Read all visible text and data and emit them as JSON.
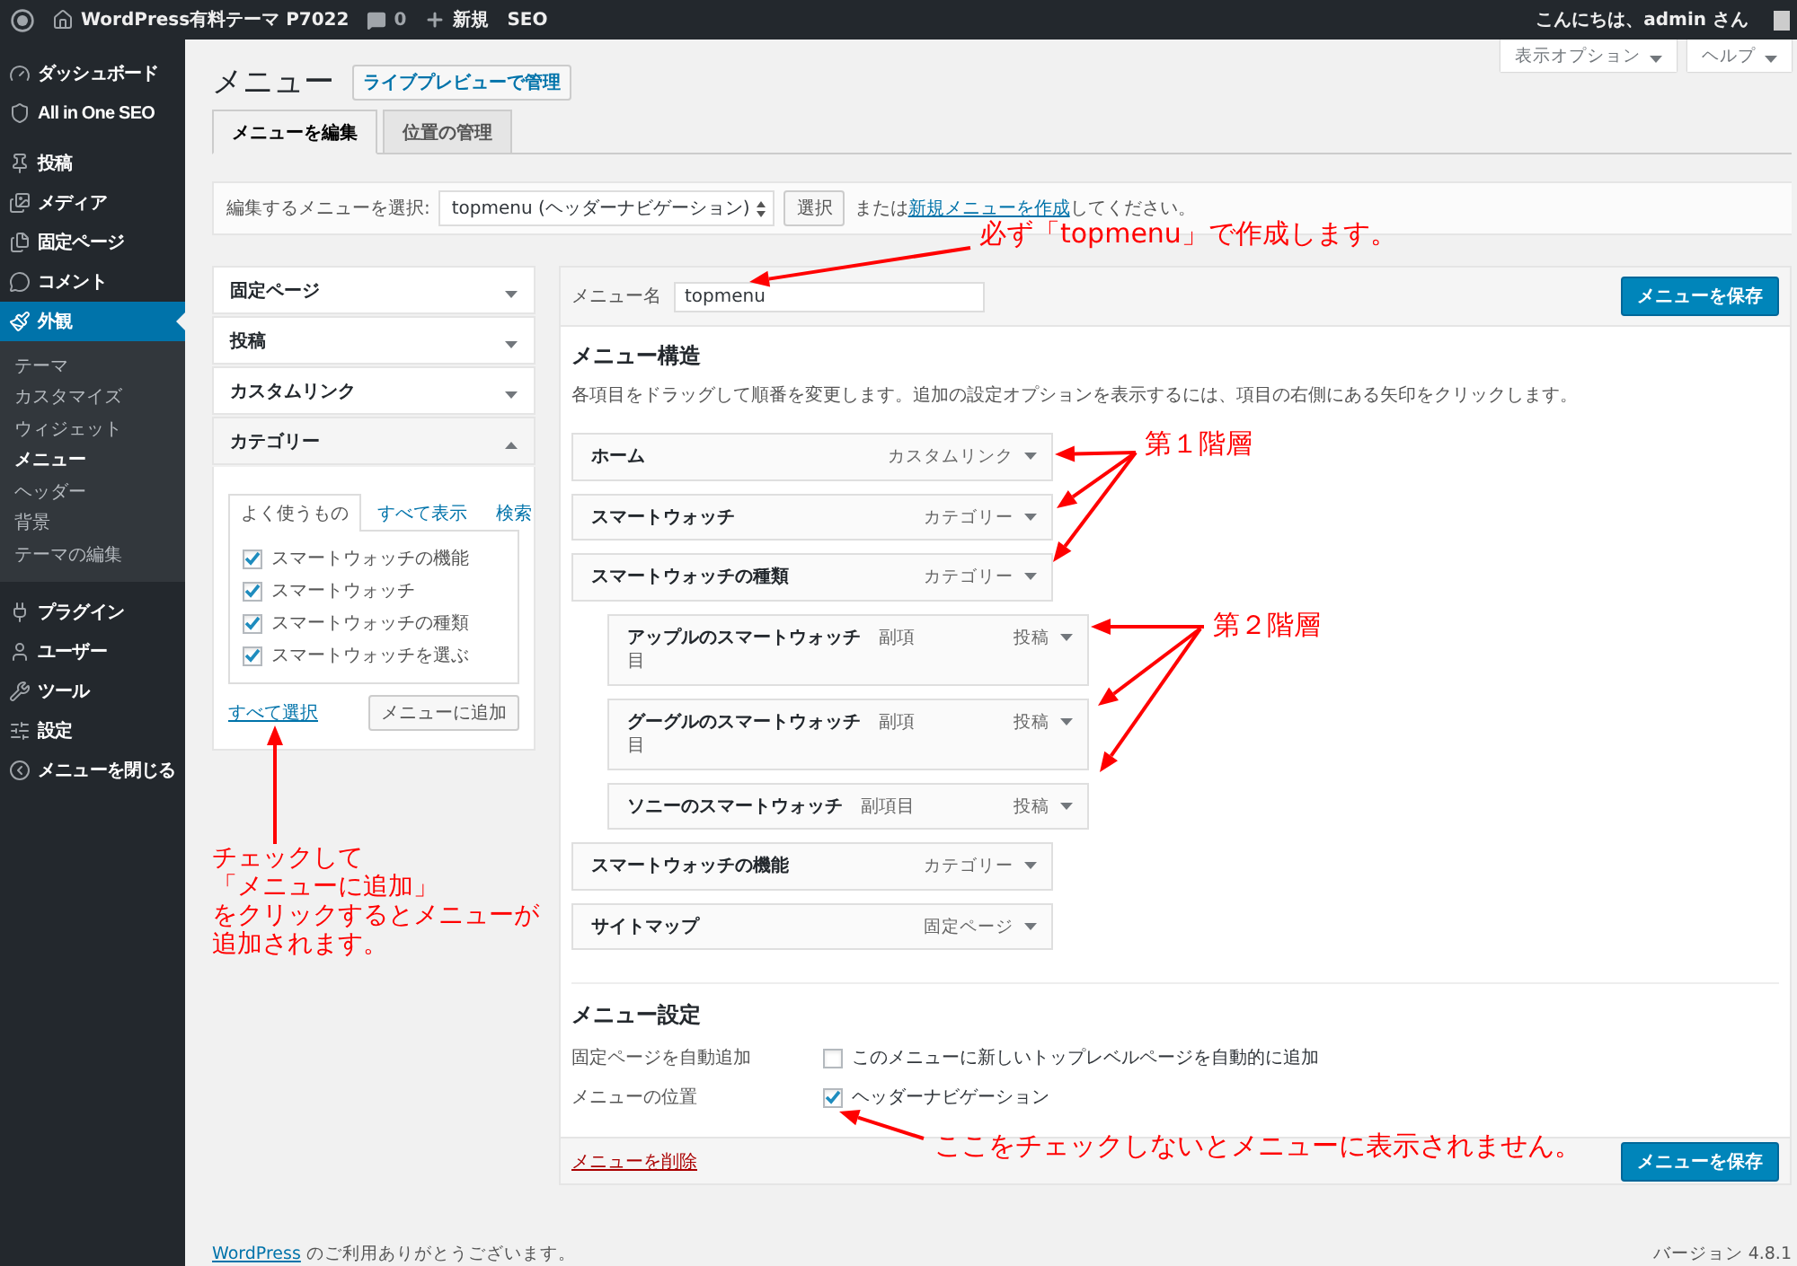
{
  "admin_bar": {
    "site_name": "WordPress有料テーマ P7022",
    "comment_count": "0",
    "new_label": "新規",
    "seo_label": "SEO",
    "greeting": "こんにちは、admin さん"
  },
  "sidebar": {
    "items": [
      {
        "label": "ダッシュボード",
        "selected": false
      },
      {
        "label": "All in One SEO",
        "selected": false
      },
      {
        "label": "投稿",
        "selected": false
      },
      {
        "label": "メディア",
        "selected": false
      },
      {
        "label": "固定ページ",
        "selected": false
      },
      {
        "label": "コメント",
        "selected": false
      },
      {
        "label": "外観",
        "selected": true,
        "children": [
          {
            "label": "テーマ",
            "selected": false
          },
          {
            "label": "カスタマイズ",
            "selected": false
          },
          {
            "label": "ウィジェット",
            "selected": false
          },
          {
            "label": "メニュー",
            "selected": true
          },
          {
            "label": "ヘッダー",
            "selected": false
          },
          {
            "label": "背景",
            "selected": false
          },
          {
            "label": "テーマの編集",
            "selected": false
          }
        ]
      },
      {
        "label": "プラグイン",
        "selected": false
      },
      {
        "label": "ユーザー",
        "selected": false
      },
      {
        "label": "ツール",
        "selected": false
      },
      {
        "label": "設定",
        "selected": false
      },
      {
        "label": "メニューを閉じる",
        "selected": false
      }
    ]
  },
  "screen_options": [
    {
      "label": "表示オプション"
    },
    {
      "label": "ヘルプ"
    }
  ],
  "page_title": "メニュー",
  "live_preview_button": "ライブプレビューで管理",
  "tabs": [
    {
      "label": "メニューを編集",
      "selected": true
    },
    {
      "label": "位置の管理",
      "selected": false
    }
  ],
  "menu_select": {
    "label": "編集するメニューを選択:",
    "value": "topmenu (ヘッダーナビゲーション)",
    "button": "選択",
    "hint_before": "または",
    "hint_link": "新規メニューを作成",
    "hint_after": "してください。"
  },
  "add_items": {
    "sections": [
      {
        "title": "固定ページ",
        "expanded": false
      },
      {
        "title": "投稿",
        "expanded": false
      },
      {
        "title": "カスタムリンク",
        "expanded": false
      },
      {
        "title": "カテゴリー",
        "expanded": true,
        "tabs": [
          {
            "label": "よく使うもの",
            "selected": true
          },
          {
            "label": "すべて表示",
            "selected": false
          },
          {
            "label": "検索",
            "selected": false
          }
        ],
        "items": [
          {
            "label": "スマートウォッチの機能",
            "checked": true
          },
          {
            "label": "スマートウォッチ",
            "checked": true
          },
          {
            "label": "スマートウォッチの種類",
            "checked": true
          },
          {
            "label": "スマートウォッチを選ぶ",
            "checked": true
          }
        ],
        "select_all": "すべて選択",
        "add_button": "メニューに追加"
      }
    ]
  },
  "menu_editor": {
    "name_label": "メニュー名",
    "name_value": "topmenu",
    "save_button": "メニューを保存",
    "structure_heading": "メニュー構造",
    "structure_hint": "各項目をドラッグして順番を変更します。追加の設定オプションを表示するには、項目の右側にある矢印をクリックします。",
    "items": [
      {
        "title": "ホーム",
        "type": "カスタムリンク"
      },
      {
        "title": "スマートウォッチ",
        "type": "カテゴリー"
      },
      {
        "title": "スマートウォッチの種類",
        "type": "カテゴリー",
        "children": [
          {
            "title": "アップルのスマートウォッチ",
            "sub_label": "副項目",
            "type": "投稿"
          },
          {
            "title": "グーグルのスマートウォッチ",
            "sub_label": "副項目",
            "type": "投稿"
          },
          {
            "title": "ソニーのスマートウォッチ",
            "sub_label": "副項目",
            "type": "投稿"
          }
        ]
      },
      {
        "title": "スマートウォッチの機能",
        "type": "カテゴリー"
      },
      {
        "title": "サイトマップ",
        "type": "固定ページ"
      }
    ],
    "settings_heading": "メニュー設定",
    "settings": [
      {
        "label": "固定ページを自動追加",
        "option": "このメニューに新しいトップレベルページを自動的に追加",
        "checked": false
      },
      {
        "label": "メニューの位置",
        "option": "ヘッダーナビゲーション",
        "checked": true
      }
    ],
    "delete_link": "メニューを削除",
    "save_button_bottom": "メニューを保存"
  },
  "footer": {
    "thanks_link": "WordPress",
    "thanks_text": "のご利用ありがとうございます。",
    "version": "バージョン 4.8.1"
  },
  "annotations": [
    {
      "text": "必ず「topmenu」で作成します。"
    },
    {
      "text": "第１階層"
    },
    {
      "text": "第２階層"
    },
    {
      "lines": [
        "チェックして",
        "「メニューに追加」",
        "をクリックするとメニューが",
        "追加されます。"
      ]
    },
    {
      "text": "ここをチェックしないとメニューに表示されません。"
    }
  ]
}
